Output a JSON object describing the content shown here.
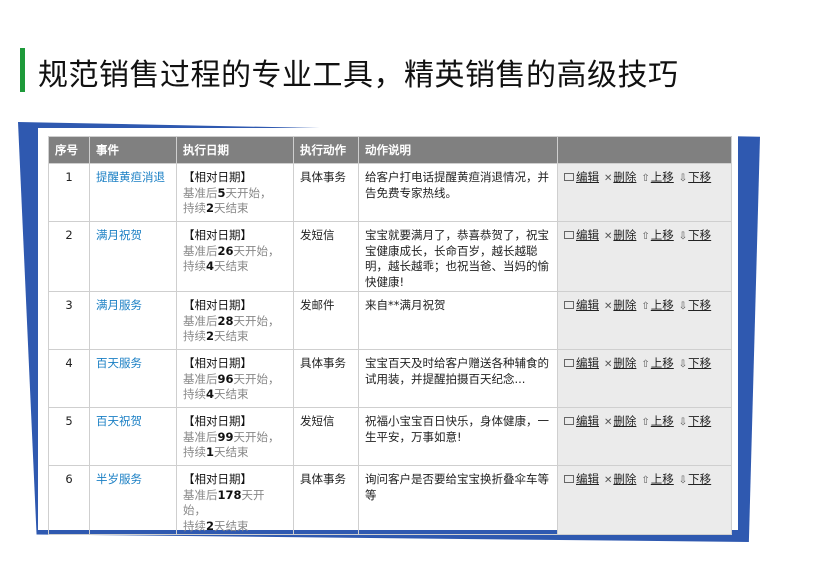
{
  "page": {
    "title": "规范销售过程的专业工具，精英销售的高级技巧"
  },
  "table": {
    "headers": [
      "序号",
      "事件",
      "执行日期",
      "执行动作",
      "动作说明",
      ""
    ],
    "rows": [
      {
        "num": "1",
        "event": "提醒黄疸消退",
        "date_type": "【相对日期】",
        "base_prefix": "基准后",
        "start_days": "5",
        "start_suffix": "天开始，",
        "dur_prefix": "持续",
        "dur_days": "2",
        "dur_suffix": "天结束",
        "action": "具体事务",
        "desc": "给客户打电话提醒黄疸消退情况，并告免费专家热线。"
      },
      {
        "num": "2",
        "event": "满月祝贺",
        "date_type": "【相对日期】",
        "base_prefix": "基准后",
        "start_days": "26",
        "start_suffix": "天开始，",
        "dur_prefix": "持续",
        "dur_days": "4",
        "dur_suffix": "天结束",
        "action": "发短信",
        "desc": "宝宝就要满月了，恭喜恭贺了，祝宝宝健康成长，长命百岁，越长越聪明，越长越乖；也祝当爸、当妈的愉快健康!"
      },
      {
        "num": "3",
        "event": "满月服务",
        "date_type": "【相对日期】",
        "base_prefix": "基准后",
        "start_days": "28",
        "start_suffix": "天开始，",
        "dur_prefix": "持续",
        "dur_days": "2",
        "dur_suffix": "天结束",
        "action": "发邮件",
        "desc": "来自**满月祝贺"
      },
      {
        "num": "4",
        "event": "百天服务",
        "date_type": "【相对日期】",
        "base_prefix": "基准后",
        "start_days": "96",
        "start_suffix": "天开始，",
        "dur_prefix": "持续",
        "dur_days": "4",
        "dur_suffix": "天结束",
        "action": "具体事务",
        "desc": "宝宝百天及时给客户赠送各种辅食的试用装，并提醒拍摄百天纪念..."
      },
      {
        "num": "5",
        "event": "百天祝贺",
        "date_type": "【相对日期】",
        "base_prefix": "基准后",
        "start_days": "99",
        "start_suffix": "天开始，",
        "dur_prefix": "持续",
        "dur_days": "1",
        "dur_suffix": "天结束",
        "action": "发短信",
        "desc": "祝福小宝宝百日快乐，身体健康，一生平安，万事如意!"
      },
      {
        "num": "6",
        "event": "半岁服务",
        "date_type": "【相对日期】",
        "base_prefix": "基准后",
        "start_days": "178",
        "start_suffix": "天开始，",
        "dur_prefix": "持续",
        "dur_days": "2",
        "dur_suffix": "天结束",
        "action": "具体事务",
        "desc": "询问客户是否要给宝宝换折叠伞车等等"
      }
    ],
    "ops": {
      "edit": "编辑",
      "delete": "删除",
      "up": "上移",
      "down": "下移"
    }
  },
  "colors": {
    "accent_green": "#1e9a3a",
    "frame_blue": "#2f59b0",
    "header_gray": "#808080",
    "link_blue": "#1a7fc4",
    "ops_bg": "#ebebeb"
  },
  "icons": [
    "edit-icon",
    "delete-icon",
    "up-arrow-icon",
    "down-arrow-icon"
  ]
}
